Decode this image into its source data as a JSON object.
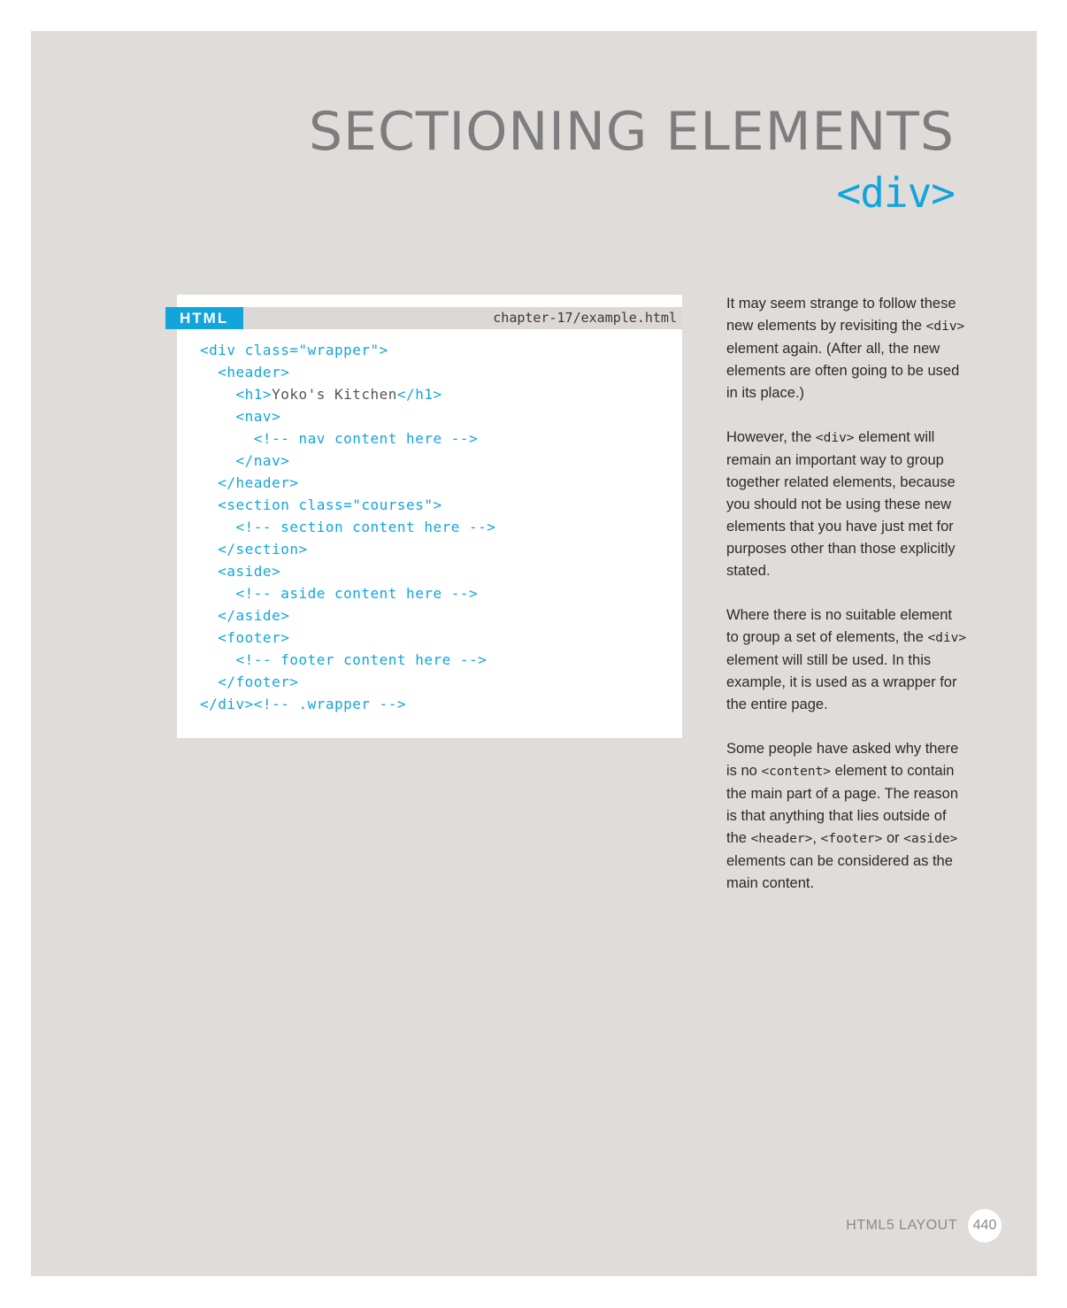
{
  "heading": {
    "title": "SECTIONING ELEMENTS",
    "tag": "<div>"
  },
  "code_panel": {
    "language": "HTML",
    "filename": "chapter-17/example.html",
    "lines": [
      [
        "<div class=\"wrapper\">"
      ],
      [
        "  <header>"
      ],
      [
        "    <h1>",
        "Yoko's Kitchen",
        "</h1>"
      ],
      [
        "    <nav>"
      ],
      [
        "      <!-- nav content here -->"
      ],
      [
        "    </nav>"
      ],
      [
        "  </header>"
      ],
      [
        "  <section class=\"courses\">"
      ],
      [
        "    <!-- section content here -->"
      ],
      [
        "  </section>"
      ],
      [
        "  <aside>"
      ],
      [
        "    <!-- aside content here -->"
      ],
      [
        "  </aside>"
      ],
      [
        "  <footer>"
      ],
      [
        "    <!-- footer content here -->"
      ],
      [
        "  </footer>"
      ],
      [
        "</div><!-- .wrapper -->"
      ]
    ]
  },
  "body": {
    "p1": {
      "a": "It may seem strange to follow these new elements by revisiting the ",
      "code1": "<div>",
      "b": " element again. (After all, the new elements are often going to be used in its place.)"
    },
    "p2": {
      "a": "However, the ",
      "code1": "<div>",
      "b": " element will remain an important way to group together related elements, because you should not be using these new elements that you have just met for purposes other than those explicitly stated."
    },
    "p3": {
      "a": "Where there is no suitable element to group a set of elements, the ",
      "code1": "<div>",
      "b": " element will still be used. In this example, it is used as a wrapper for the entire page."
    },
    "p4": {
      "a": "Some people have asked why there is no ",
      "code1": "<content>",
      "b": " element to contain the main part of a page. The reason is that anything that lies outside of the ",
      "code2": "<header>",
      "c": ", ",
      "code3": "<footer>",
      "d": " or ",
      "code4": "<aside>",
      "e": " elements can be considered as the main content."
    }
  },
  "footer": {
    "section_label": "HTML5 LAYOUT",
    "page_number": "440"
  }
}
